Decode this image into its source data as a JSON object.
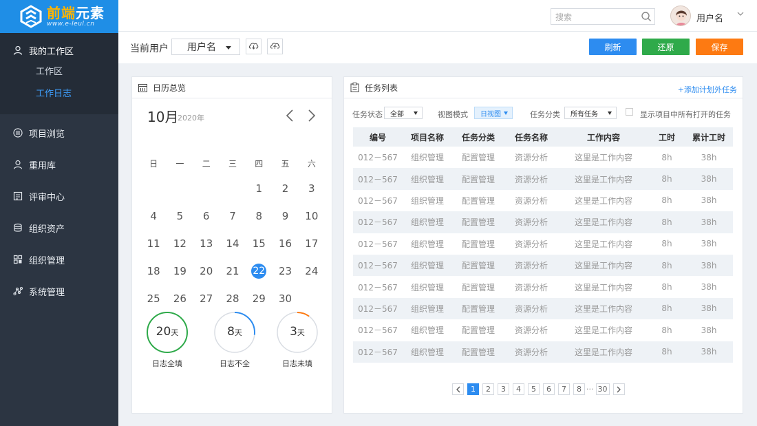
{
  "brand": {
    "title_part1": "前端",
    "title_part2": "元素",
    "url": "www.e-leul.cn"
  },
  "sidebar": {
    "workspace_label": "我的工作区",
    "workspace_items": [
      {
        "label": "工作区"
      },
      {
        "label": "工作日志",
        "active": true
      }
    ],
    "items": [
      {
        "label": "项目浏览",
        "icon": "list-icon"
      },
      {
        "label": "重用库",
        "icon": "user-icon"
      },
      {
        "label": "评审中心",
        "icon": "review-icon"
      },
      {
        "label": "组织资产",
        "icon": "database-icon"
      },
      {
        "label": "组织管理",
        "icon": "grid-icon"
      },
      {
        "label": "系统管理",
        "icon": "network-icon"
      }
    ]
  },
  "header": {
    "search_placeholder": "搜索",
    "username": "用户名"
  },
  "toolbar": {
    "current_user_label": "当前用户",
    "user_select_value": "用户名",
    "refresh_label": "刷新",
    "restore_label": "还原",
    "save_label": "保存",
    "colors": {
      "refresh": "#2d8cf0",
      "restore": "#2faa4a",
      "save": "#fd7a12"
    }
  },
  "calendar": {
    "panel_title": "日历总览",
    "month": "10月",
    "year": "2020年",
    "weekdays": [
      "日",
      "一",
      "二",
      "三",
      "四",
      "五",
      "六"
    ],
    "weeks": [
      [
        "",
        "",
        "",
        "",
        "1",
        "2",
        "3"
      ],
      [
        "4",
        "5",
        "6",
        "7",
        "8",
        "9",
        "10"
      ],
      [
        "11",
        "12",
        "13",
        "14",
        "15",
        "16",
        "17"
      ],
      [
        "18",
        "19",
        "20",
        "21",
        "22",
        "23",
        "24"
      ],
      [
        "25",
        "26",
        "27",
        "28",
        "29",
        "30",
        ""
      ]
    ],
    "today": "22",
    "stats": [
      {
        "value": "20",
        "unit": "天",
        "label": "日志全填",
        "color": "#2faa4a",
        "fraction": 1.0
      },
      {
        "value": "8",
        "unit": "天",
        "label": "日志不全",
        "color": "#2d8cf0",
        "fraction": 0.27
      },
      {
        "value": "3",
        "unit": "天",
        "label": "日志未填",
        "color": "#fd7a12",
        "fraction": 0.1
      }
    ]
  },
  "tasks": {
    "panel_title": "任务列表",
    "add_link": "+添加计划外任务",
    "filters": {
      "status_label": "任务状态",
      "status_value": "全部",
      "view_label": "视图模式",
      "view_value": "日视图",
      "category_label": "任务分类",
      "category_value": "所有任务",
      "show_open_label": "显示项目中所有打开的任务"
    },
    "columns": [
      "编号",
      "项目名称",
      "任务分类",
      "任务名称",
      "工作内容",
      "工时",
      "累计工时"
    ],
    "rows": [
      [
        "012－567",
        "组织管理",
        "配置管理",
        "资源分析",
        "这里是工作内容",
        "8h",
        "38h"
      ],
      [
        "012－567",
        "组织管理",
        "配置管理",
        "资源分析",
        "这里是工作内容",
        "8h",
        "38h"
      ],
      [
        "012－567",
        "组织管理",
        "配置管理",
        "资源分析",
        "这里是工作内容",
        "8h",
        "38h"
      ],
      [
        "012－567",
        "组织管理",
        "配置管理",
        "资源分析",
        "这里是工作内容",
        "8h",
        "38h"
      ],
      [
        "012－567",
        "组织管理",
        "配置管理",
        "资源分析",
        "这里是工作内容",
        "8h",
        "38h"
      ],
      [
        "012－567",
        "组织管理",
        "配置管理",
        "资源分析",
        "这里是工作内容",
        "8h",
        "38h"
      ],
      [
        "012－567",
        "组织管理",
        "配置管理",
        "资源分析",
        "这里是工作内容",
        "8h",
        "38h"
      ],
      [
        "012－567",
        "组织管理",
        "配置管理",
        "资源分析",
        "这里是工作内容",
        "8h",
        "38h"
      ],
      [
        "012－567",
        "组织管理",
        "配置管理",
        "资源分析",
        "这里是工作内容",
        "8h",
        "38h"
      ],
      [
        "012－567",
        "组织管理",
        "配置管理",
        "资源分析",
        "这里是工作内容",
        "8h",
        "38h"
      ]
    ],
    "pagination": {
      "pages": [
        "1",
        "2",
        "3",
        "4",
        "5",
        "6",
        "7",
        "8"
      ],
      "ellipsis": "···",
      "last": "30",
      "current": "1"
    }
  }
}
